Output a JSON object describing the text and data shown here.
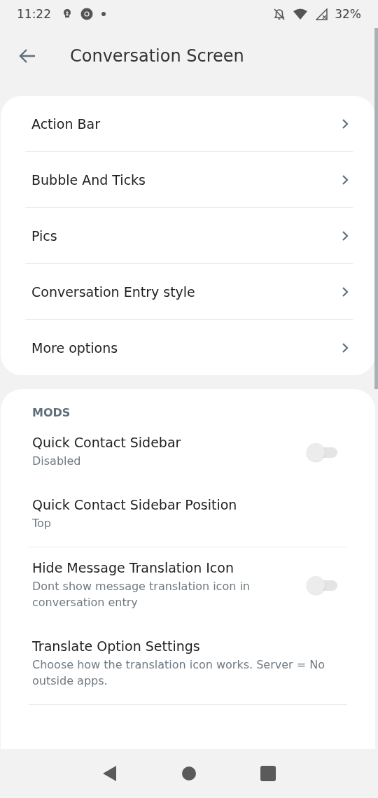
{
  "status_bar": {
    "time": "11:22",
    "battery": "32%"
  },
  "app_bar": {
    "title": "Conversation Screen"
  },
  "menu": [
    {
      "label": "Action Bar"
    },
    {
      "label": "Bubble And Ticks"
    },
    {
      "label": "Pics"
    },
    {
      "label": "Conversation Entry style"
    },
    {
      "label": "More options"
    }
  ],
  "mods": {
    "heading": "MODS",
    "groups": [
      [
        {
          "kind": "switch",
          "title": "Quick Contact Sidebar",
          "summary": "Disabled",
          "on": false
        },
        {
          "kind": "plain",
          "title": "Quick Contact Sidebar Position",
          "summary": "Top"
        }
      ],
      [
        {
          "kind": "switch",
          "title": "Hide Message Translation Icon",
          "summary": "Dont show message translation icon in conversation entry",
          "on": false
        },
        {
          "kind": "plain",
          "title": "Translate Option Settings",
          "summary": "Choose how the translation icon works. Server = No outside apps."
        }
      ]
    ]
  }
}
